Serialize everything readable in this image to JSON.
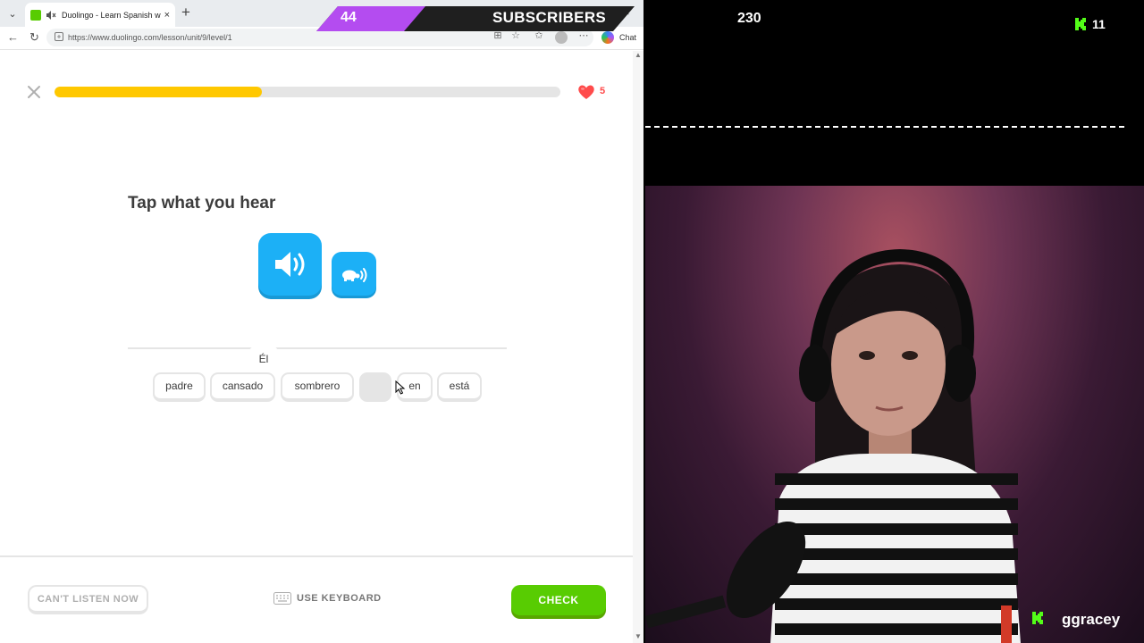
{
  "browser": {
    "tab_title": "Duolingo - Learn Spanish with",
    "url": "https://www.duolingo.com/lesson/unit/9/level/1",
    "chat_label": "Chat"
  },
  "lesson": {
    "progress_fraction": 0.41,
    "hearts": "5",
    "prompt": "Tap what you hear",
    "selected_words": [
      "Él"
    ],
    "word_bank": [
      "padre",
      "cansado",
      "sombrero",
      "",
      "en",
      "está"
    ],
    "footer": {
      "cant_listen": "CAN'T LISTEN NOW",
      "use_keyboard": "USE KEYBOARD",
      "check": "CHECK"
    }
  },
  "overlay": {
    "subscriber_count": "44",
    "subscriber_label": "SUBSCRIBERS",
    "viewer_count": "230",
    "kick_viewers": "11",
    "streamer_name": "ggracey"
  },
  "colors": {
    "duolingo_green": "#58cc02",
    "duolingo_blue": "#1cb0f6",
    "progress_yellow": "#ffc800",
    "heart_red": "#ff4b4b",
    "subs_purple": "#b44cf0",
    "kick_green": "#53fc18"
  }
}
